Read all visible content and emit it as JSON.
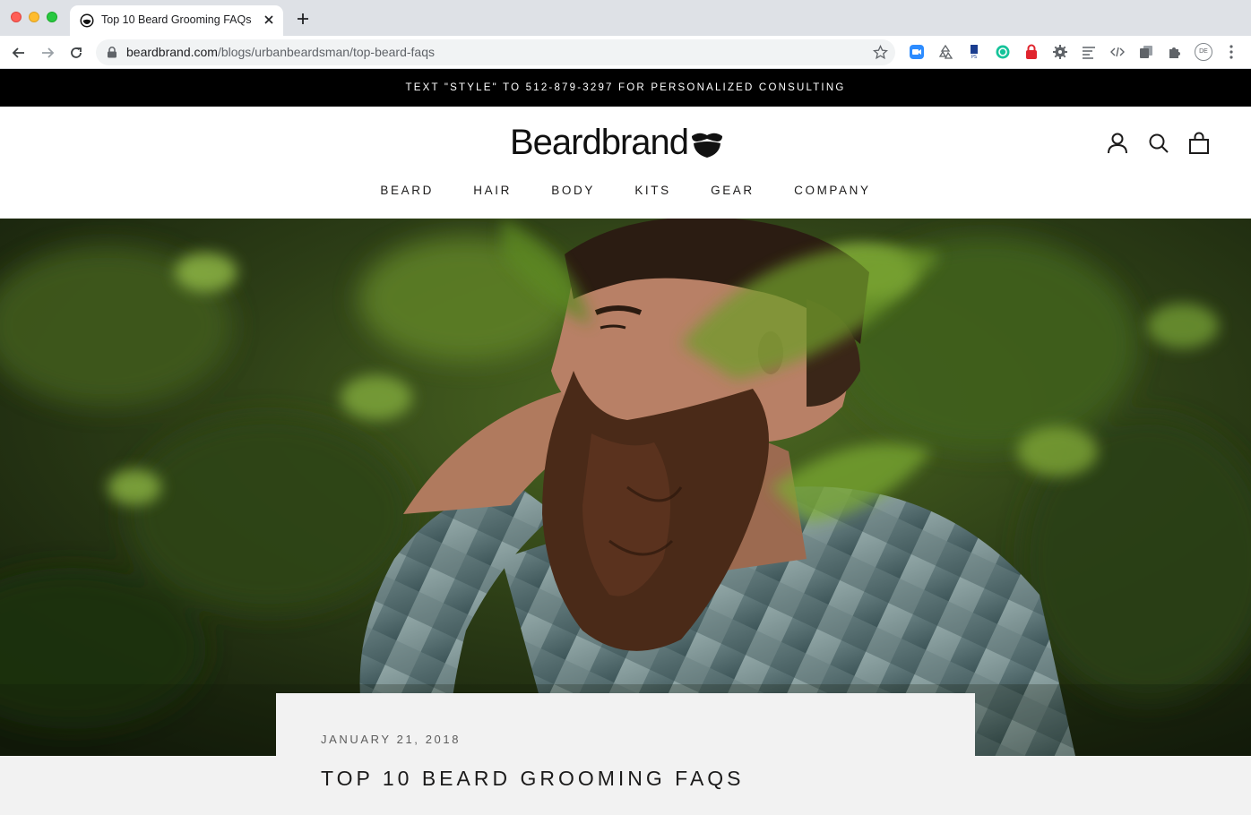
{
  "browser": {
    "tab_title": "Top 10 Beard Grooming FAQs – ",
    "url_host": "beardbrand.com",
    "url_path": "/blogs/urbanbeardsman/top-beard-faqs",
    "profile_initials": "DE"
  },
  "announcement": "TEXT \"STYLE\" TO 512-879-3297 FOR PERSONALIZED CONSULTING",
  "brand": {
    "name": "Beardbrand"
  },
  "nav": [
    "BEARD",
    "HAIR",
    "BODY",
    "KITS",
    "GEAR",
    "COMPANY"
  ],
  "article": {
    "date": "JANUARY 21, 2018",
    "title": "TOP 10 BEARD GROOMING FAQS"
  },
  "icons": {
    "header": [
      "account-icon",
      "search-icon",
      "cart-icon"
    ],
    "extensions": [
      "zoom-icon",
      "recycle-icon",
      "bookmark-extension-icon",
      "grammarly-icon",
      "password-lock-icon",
      "gear-extension-icon",
      "list-icon",
      "code-icon",
      "copy-icon",
      "puzzle-icon"
    ]
  },
  "colors": {
    "announcement_bg": "#000000",
    "page_bg": "#f2f2f2",
    "text": "#1c1b1b"
  }
}
